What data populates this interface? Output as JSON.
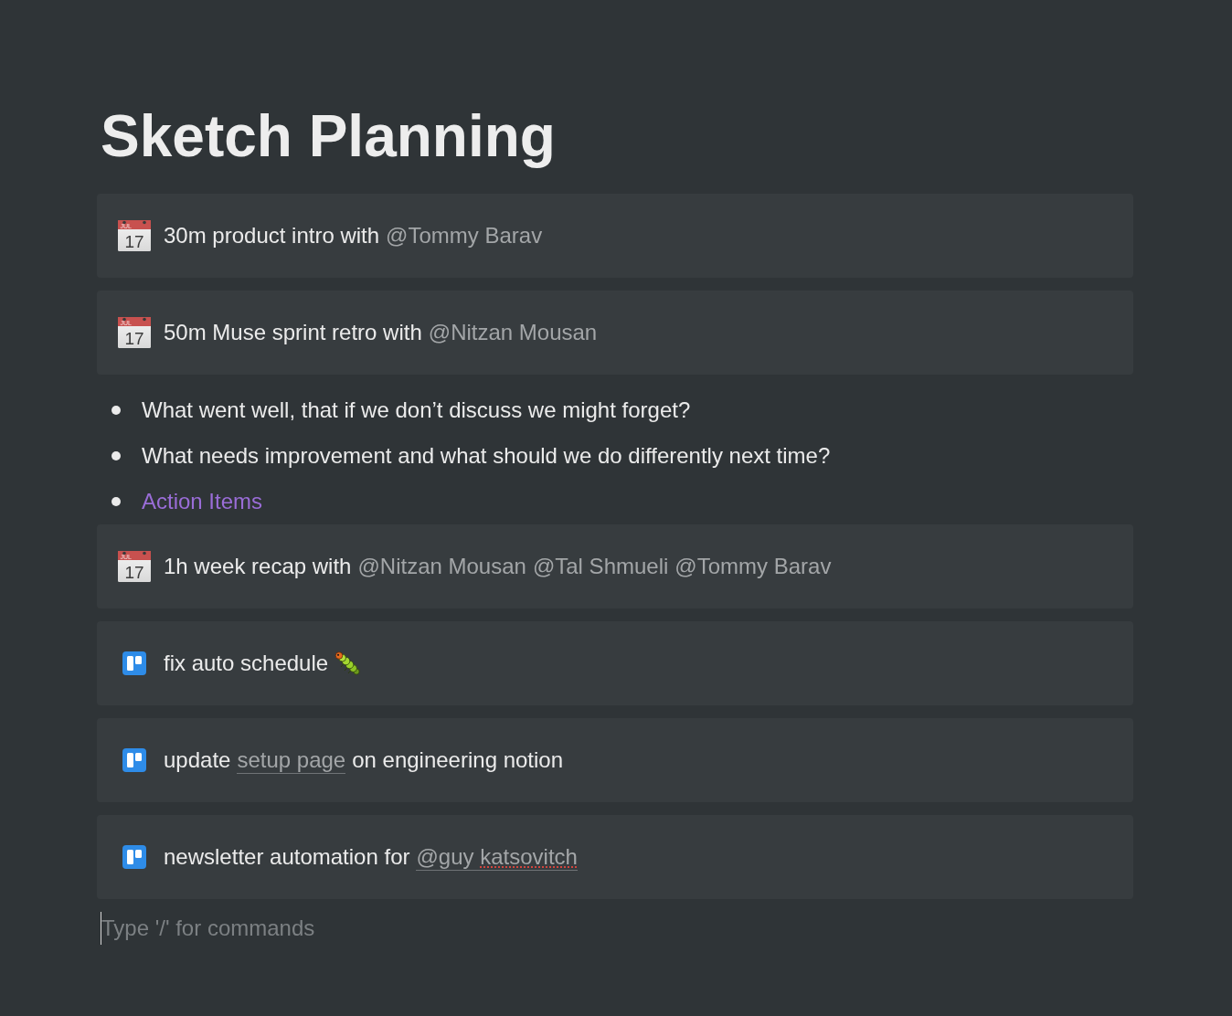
{
  "page": {
    "title": "Sketch Planning"
  },
  "blocks": [
    {
      "kind": "event",
      "calendar": {
        "month": "JUL",
        "day": "17"
      },
      "segments": [
        {
          "kind": "text",
          "text": "30m product intro with"
        },
        {
          "kind": "mention",
          "text": "@Tommy Barav"
        }
      ]
    },
    {
      "kind": "event",
      "calendar": {
        "month": "JUL",
        "day": "17"
      },
      "segments": [
        {
          "kind": "text",
          "text": "50m Muse sprint retro with"
        },
        {
          "kind": "mention",
          "text": "@Nitzan Mousan"
        }
      ]
    },
    {
      "kind": "bullet",
      "color": "#ebebeb",
      "text": "What went well, that if we don’t discuss we might forget?"
    },
    {
      "kind": "bullet",
      "color": "#ebebeb",
      "text": "What needs improvement and what should we do differently next time?"
    },
    {
      "kind": "bullet",
      "color": "#9a6dd7",
      "text": "Action Items"
    },
    {
      "kind": "event",
      "calendar": {
        "month": "JUL",
        "day": "17"
      },
      "segments": [
        {
          "kind": "text",
          "text": "1h week recap with"
        },
        {
          "kind": "mention",
          "text": "@Nitzan Mousan"
        },
        {
          "kind": "mention",
          "text": "@Tal Shmueli"
        },
        {
          "kind": "mention",
          "text": "@Tommy Barav"
        }
      ]
    },
    {
      "kind": "task",
      "segments": [
        {
          "kind": "text",
          "text": "fix auto schedule"
        },
        {
          "kind": "emoji"
        }
      ]
    },
    {
      "kind": "task",
      "segments": [
        {
          "kind": "text",
          "text": "update"
        },
        {
          "kind": "link",
          "text": "setup page"
        },
        {
          "kind": "text",
          "text": "on engineering notion"
        }
      ]
    },
    {
      "kind": "task",
      "segments": [
        {
          "kind": "text",
          "text": "newsletter automation for"
        },
        {
          "kind": "link",
          "words": [
            {
              "text": "@guy",
              "misspelled": false
            },
            {
              "text": "katsovitch",
              "misspelled": true
            }
          ]
        }
      ]
    }
  ],
  "command_input": {
    "placeholder": "Type '/' for commands",
    "focused": true
  }
}
